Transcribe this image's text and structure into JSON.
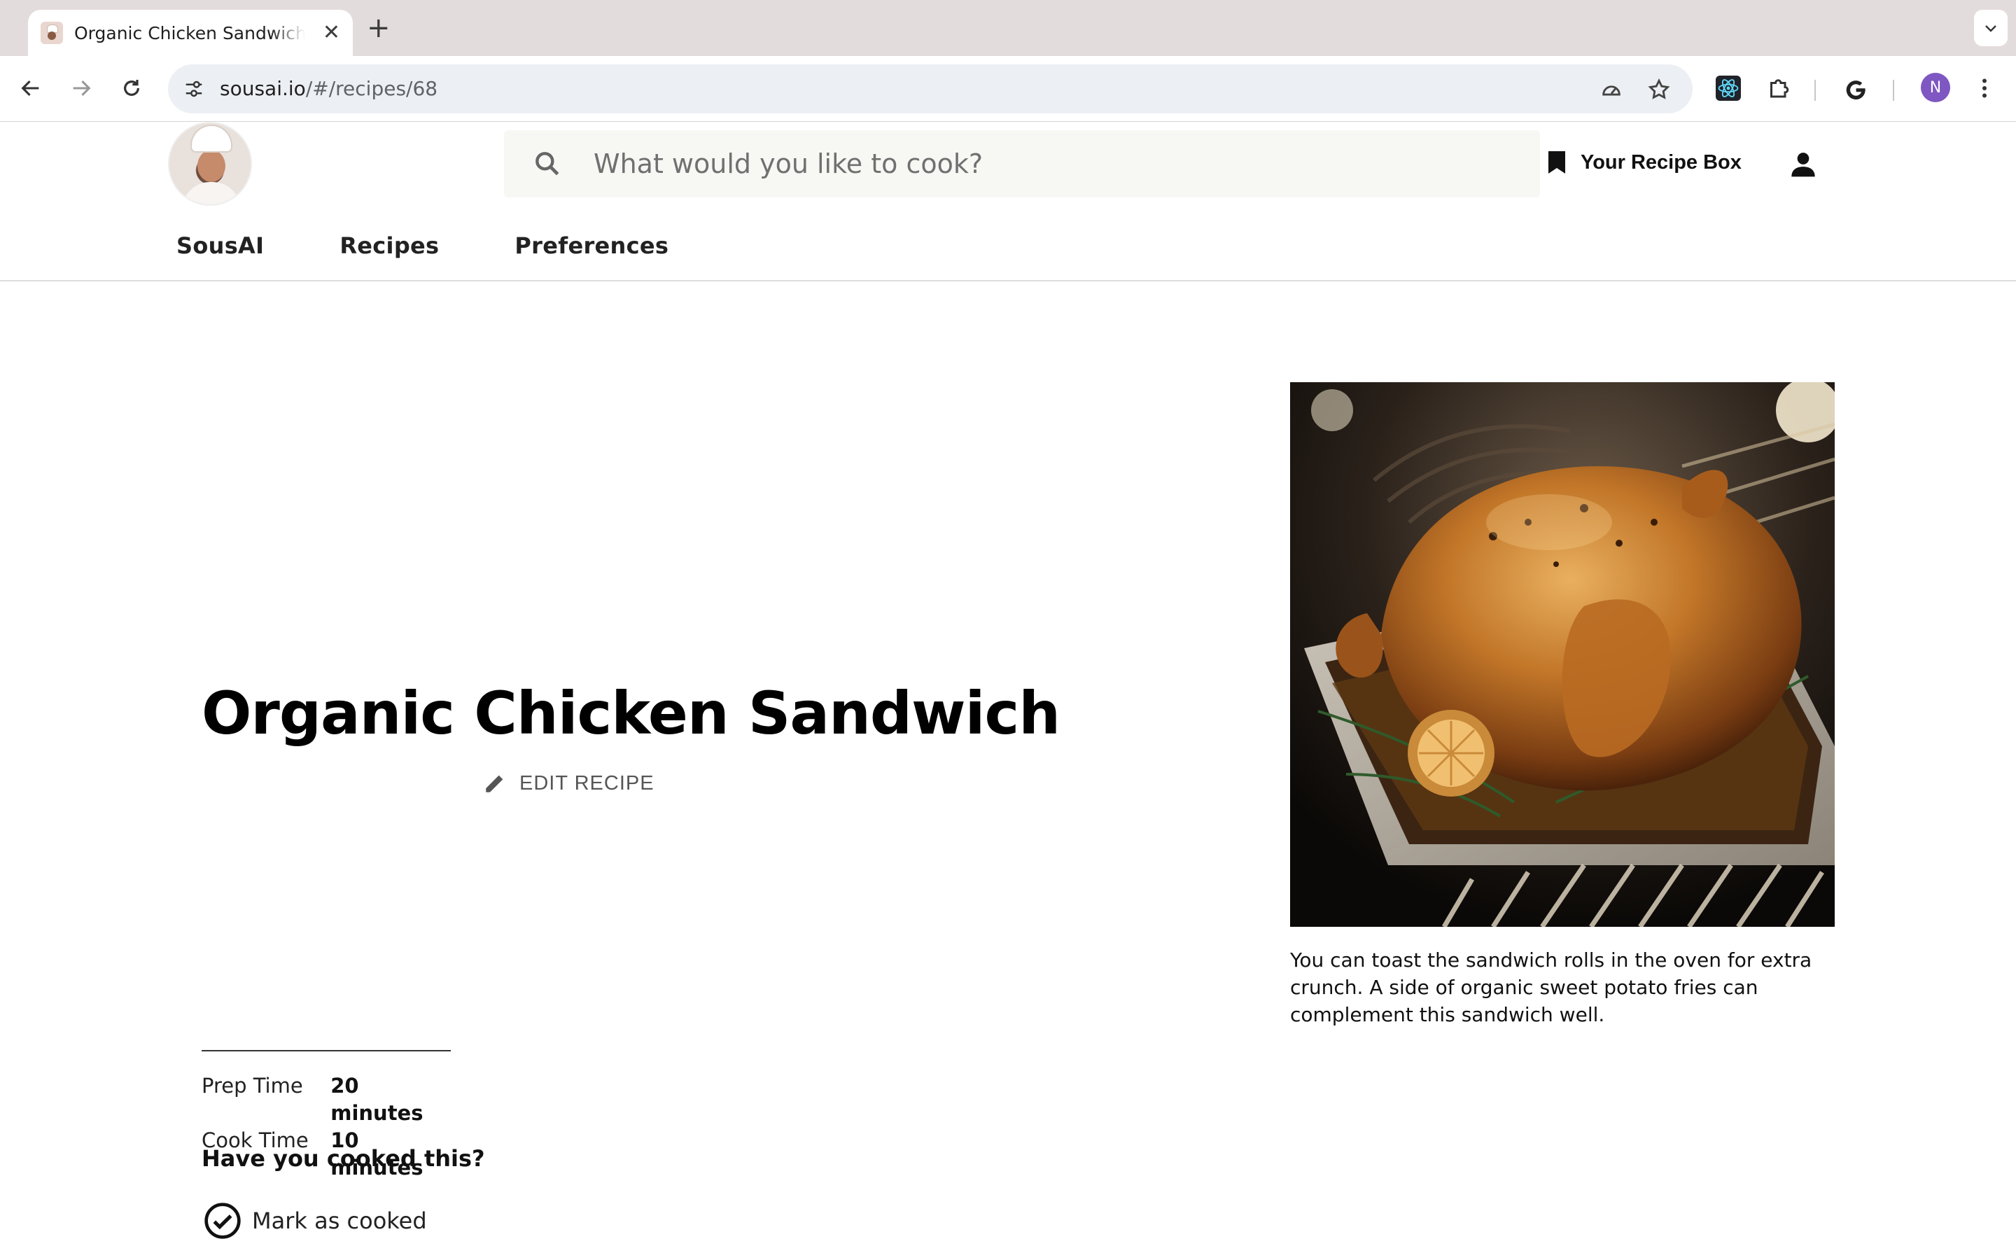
{
  "browser": {
    "tab_title": "Organic Chicken Sandwich Recipe",
    "url_host": "sousai.io",
    "url_path": "/#/recipes/68",
    "profile_initial": "N"
  },
  "header": {
    "search_placeholder": "What would you like to cook?",
    "recipe_box_label": "Your Recipe Box",
    "nav": {
      "sousai": "SousAI",
      "recipes": "Recipes",
      "preferences": "Preferences"
    }
  },
  "recipe": {
    "title": "Organic Chicken Sandwich",
    "edit_label": "EDIT RECIPE",
    "image_alt": "Roast chicken in oven tray",
    "note": "You can toast the sandwich rolls in the oven for extra crunch. A side of organic sweet potato fries can complement this sandwich well.",
    "prep_time_label": "Prep Time",
    "prep_time_value": "20 minutes",
    "cook_time_label": "Cook Time",
    "cook_time_value": "10 minutes",
    "cooked_question": "Have you cooked this?",
    "mark_cooked_label": "Mark as cooked"
  },
  "icons": {
    "search": "search-icon",
    "bookmark": "bookmark-icon",
    "account": "account-icon",
    "edit": "pencil-icon",
    "check": "check-circle-icon"
  }
}
